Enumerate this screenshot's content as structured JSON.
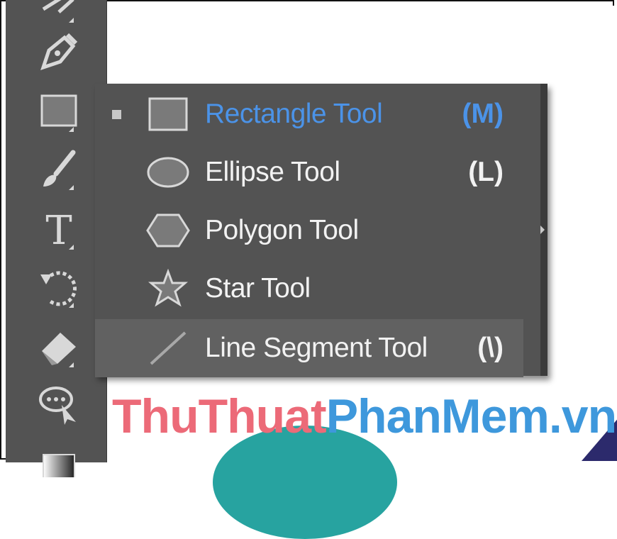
{
  "toolbar": {
    "tools": [
      {
        "icon": "curvature-tool-icon"
      },
      {
        "icon": "pen-tool-icon"
      },
      {
        "icon": "rectangle-tool-icon"
      },
      {
        "icon": "paintbrush-tool-icon"
      },
      {
        "icon": "type-tool-icon",
        "glyph": "T"
      },
      {
        "icon": "rotate-tool-icon"
      },
      {
        "icon": "eraser-tool-icon"
      },
      {
        "icon": "puppet-warp-tool-icon"
      },
      {
        "icon": "gradient-tool-icon"
      }
    ]
  },
  "flyout": {
    "items": [
      {
        "label": "Rectangle Tool",
        "shortcut": "(M)",
        "icon": "rectangle-icon",
        "active": true
      },
      {
        "label": "Ellipse Tool",
        "shortcut": "(L)",
        "icon": "ellipse-icon"
      },
      {
        "label": "Polygon Tool",
        "shortcut": "",
        "icon": "polygon-icon"
      },
      {
        "label": "Star Tool",
        "shortcut": "",
        "icon": "star-icon"
      },
      {
        "label": "Line Segment Tool",
        "shortcut": "(\\)",
        "icon": "line-segment-icon",
        "hovered": true
      }
    ]
  },
  "watermark": {
    "part1": "ThuThuat",
    "part2": "PhanMem.vn"
  },
  "colors": {
    "panel": "#535353",
    "active_text": "#4b93e8",
    "text": "#f2f2f2",
    "watermark_red": "#ec6a78",
    "watermark_blue": "#3e98dc"
  }
}
